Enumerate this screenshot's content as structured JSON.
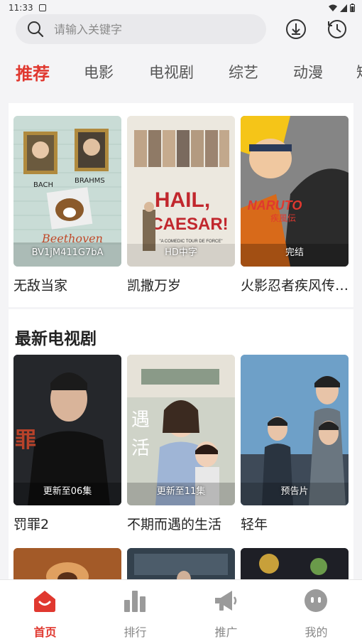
{
  "status_bar": {
    "time": "11:33"
  },
  "search": {
    "placeholder": "请输入关键字"
  },
  "category_tabs": [
    "推荐",
    "电影",
    "电视剧",
    "综艺",
    "动漫",
    "短"
  ],
  "active_tab": "推荐",
  "recommended": [
    {
      "title": "无敌当家",
      "badge": "BV1jM411G7bA",
      "poster_text": [
        "BACH",
        "BRAHMS",
        "Beethoven"
      ]
    },
    {
      "title": "凯撒万岁",
      "badge": "HD中字",
      "poster_text": [
        "HAIL,",
        "CAESAR!",
        "\"A COMEDIC TOUR DE FORCE\""
      ]
    },
    {
      "title": "火影忍者疾风传…",
      "badge": "完结",
      "poster_text": [
        "NARUTO",
        "疾風伝"
      ]
    }
  ],
  "latest_tv": {
    "heading": "最新电视剧",
    "items": [
      {
        "title": "罚罪2",
        "badge": "更新至06集"
      },
      {
        "title": "不期而遇的生活",
        "badge": "更新至11集"
      },
      {
        "title": "轻年",
        "badge": "预告片"
      }
    ]
  },
  "bottom_nav": [
    {
      "label": "首页",
      "icon": "home-icon",
      "active": true
    },
    {
      "label": "排行",
      "icon": "ranking-icon",
      "active": false
    },
    {
      "label": "推广",
      "icon": "megaphone-icon",
      "active": false
    },
    {
      "label": "我的",
      "icon": "profile-icon",
      "active": false
    }
  ],
  "colors": {
    "accent": "#e0382f",
    "background": "#f4f4f6",
    "search_bg": "#e9e9ec"
  }
}
